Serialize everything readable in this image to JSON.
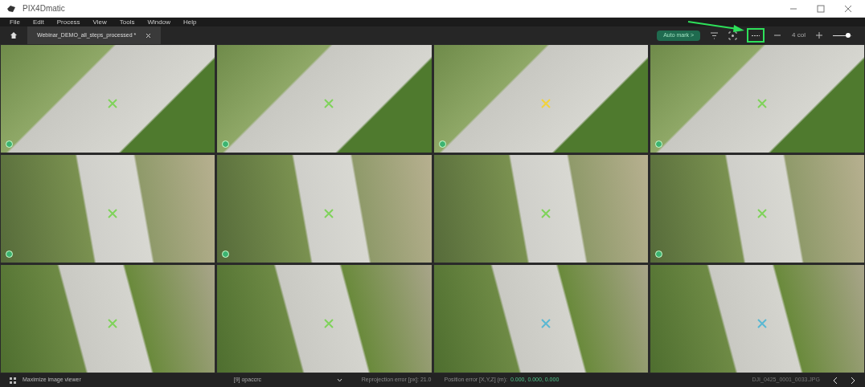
{
  "window": {
    "title": "PIX4Dmatic"
  },
  "menu": [
    "File",
    "Edit",
    "Process",
    "View",
    "Tools",
    "Window",
    "Help"
  ],
  "tabs": [
    {
      "label": "Webinar_DEMO_all_steps_processed *",
      "selected": true
    }
  ],
  "toolbar": {
    "auto_mark": "Auto mark >",
    "more_highlighted": true,
    "columns": "4 col",
    "zoom": {
      "level": 0.8
    }
  },
  "images": [
    {
      "color": "#7fd35a",
      "verified": true
    },
    {
      "color": "#7fd35a",
      "verified": true
    },
    {
      "color": "#f2d23a",
      "verified": true
    },
    {
      "color": "#7fd35a",
      "verified": true
    },
    {
      "color": "#7fd35a",
      "verified": true
    },
    {
      "color": "#7fd35a",
      "verified": true
    },
    {
      "color": "#7fd35a",
      "verified": false
    },
    {
      "color": "#7fd35a",
      "verified": true
    },
    {
      "color": "#7fd35a",
      "verified": false
    },
    {
      "color": "#7fd35a",
      "verified": false
    },
    {
      "color": "#5ab8d3",
      "verified": false
    },
    {
      "color": "#5ab8d3",
      "verified": false
    }
  ],
  "status_bar": {
    "maximize": "Maximize image viewer",
    "point": "[9] opaccrc",
    "reprojection": "Reprojection error [px]: 21.0",
    "position_label": "Position error [X,Y,Z] (m):",
    "position_value": "0.000, 0.000, 0.000",
    "filename": "DJI_0425_0001_0033.JPG"
  }
}
